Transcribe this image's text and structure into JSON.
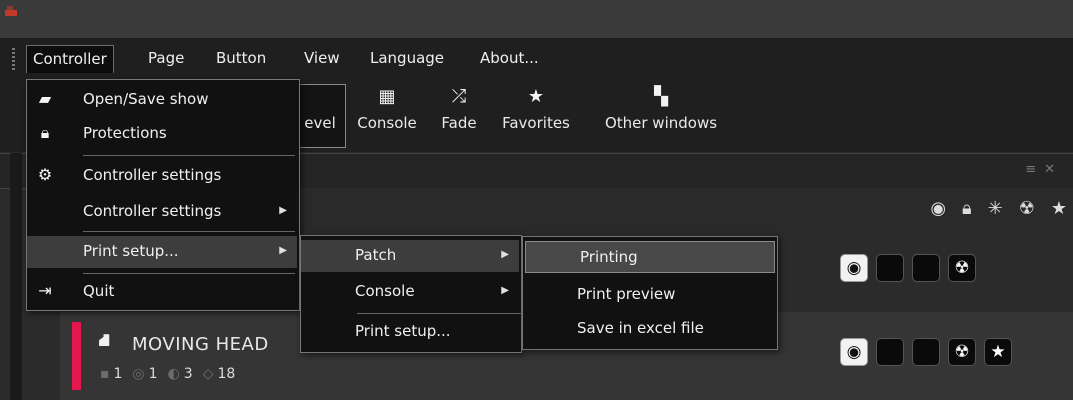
{
  "menubar": {
    "items": [
      "Controller",
      "Page",
      "Button",
      "View",
      "Language",
      "About..."
    ]
  },
  "toolbar": {
    "buttons": [
      {
        "label": "evel",
        "icon": ""
      },
      {
        "label": "Console",
        "icon": "grid-icon"
      },
      {
        "label": "Fade",
        "icon": "shuffle-icon"
      },
      {
        "label": "Favorites",
        "icon": "star-icon"
      },
      {
        "label": "Other windows",
        "icon": "windows-icon"
      }
    ]
  },
  "controller_menu": {
    "items": [
      {
        "label": "Open/Save show",
        "icon": "folder-icon"
      },
      {
        "label": "Protections",
        "icon": "lock-icon"
      },
      {
        "label": "Controller settings",
        "icon": "gear-icon"
      },
      {
        "label": "Controller settings",
        "icon": "",
        "submenu": true
      },
      {
        "label": "Print setup...",
        "icon": "",
        "submenu": true
      },
      {
        "label": "Quit",
        "icon": "exit-icon"
      }
    ]
  },
  "print_setup_menu": {
    "items": [
      {
        "label": "Patch",
        "submenu": true
      },
      {
        "label": "Console",
        "submenu": true
      },
      {
        "label": "Print setup..."
      }
    ]
  },
  "patch_menu": {
    "items": [
      {
        "label": "Printing"
      },
      {
        "label": "Print preview"
      },
      {
        "label": "Save in excel file"
      }
    ]
  },
  "device": {
    "name": "MOVING HEAD",
    "stats": [
      "1",
      "1",
      "3",
      "18"
    ],
    "accent_color": "#e3174e"
  }
}
